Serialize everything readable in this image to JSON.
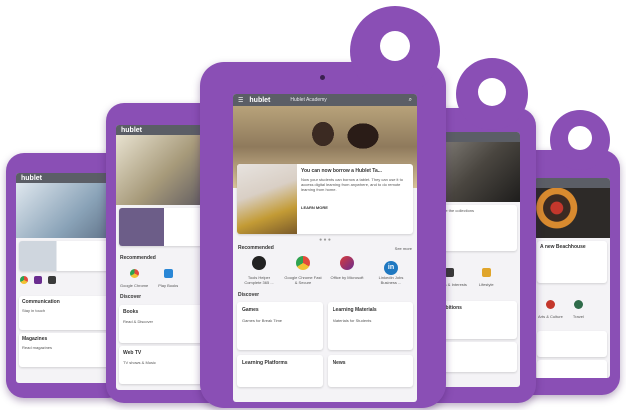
{
  "brand": {
    "name": "hublet"
  },
  "header": {
    "title": "Hublet Academy"
  },
  "featured": {
    "title": "You can now borrow a Hublet Ta...",
    "body": "Now your students can borrow a tablet. They can use it to access digital learning from anywhere, and to do remote learning from home.",
    "cta": "LEARN MORE"
  },
  "recommended": {
    "heading": "Recommended",
    "see_more": "See more",
    "apps": [
      {
        "name": "Tools Helper Complete 365 ...",
        "color": "#222222"
      },
      {
        "name": "Google Chrome Fast & Secure",
        "color": "#e24a3b"
      },
      {
        "name": "Office by Microsoft",
        "color": "#6a2c8f"
      },
      {
        "name": "LinkedIn Jobs Business ...",
        "color": "#1f78c1"
      }
    ]
  },
  "discover": {
    "heading": "Discover",
    "cards": [
      {
        "title": "Games",
        "sub": "Games for Break Time"
      },
      {
        "title": "Learning Materials",
        "sub": "Materials for Students"
      },
      {
        "title": "Learning Platforms",
        "sub": ""
      },
      {
        "title": "News",
        "sub": ""
      }
    ]
  },
  "side_left": {
    "cards": [
      {
        "title": "Books",
        "sub": "Read & Discover"
      },
      {
        "title": "Web TV",
        "sub": "TV shows & Music"
      }
    ],
    "labels": [
      "Google Chrome",
      "Play Books"
    ]
  },
  "far_left": {
    "cards": [
      {
        "title": "Communication",
        "sub": "Stay in touch"
      },
      {
        "title": "Magazines",
        "sub": "Read magazines"
      }
    ]
  },
  "right": {
    "title": "Exhibitions",
    "sub": "Explore the collections",
    "labels": [
      "Hobbies & Interests",
      "Lifestyle"
    ]
  },
  "far_right": {
    "title": "A new Beachhouse",
    "labels": [
      "Arts & Culture",
      "Travel"
    ]
  },
  "colors": {
    "case": "#8a4fb5",
    "screen": "#f4f3f6",
    "topbar": "#5b5e66",
    "accent": "#6a2c8f"
  }
}
